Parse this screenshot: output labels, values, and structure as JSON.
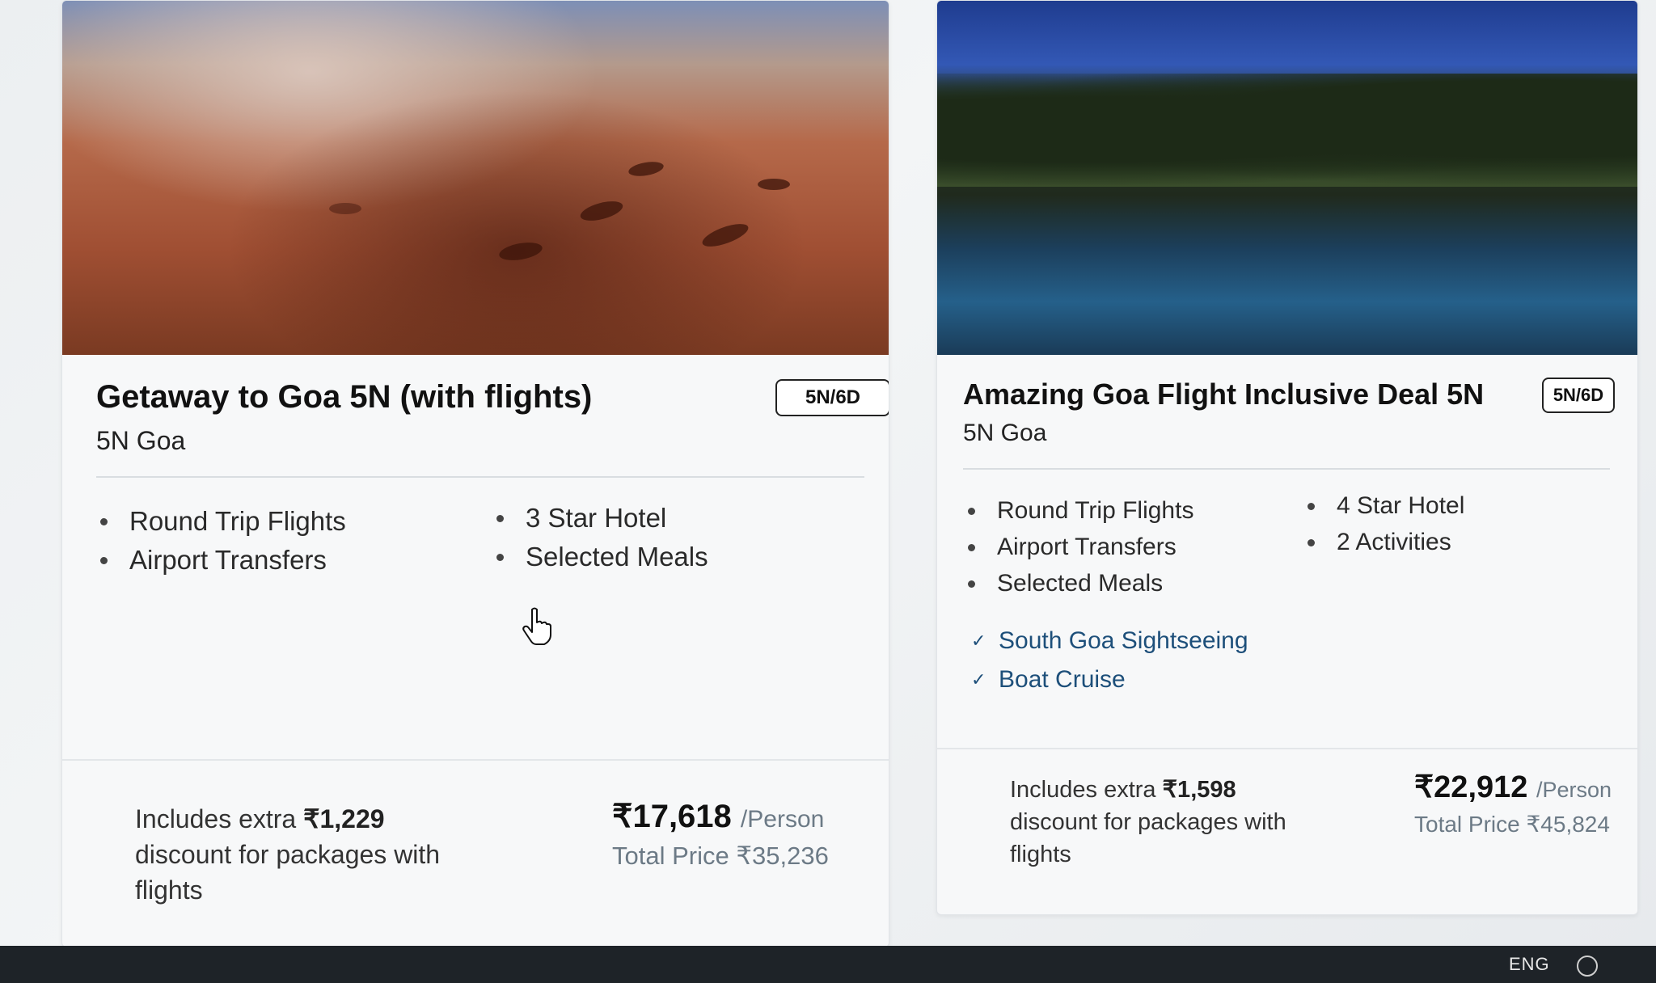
{
  "cards": [
    {
      "title": "Getaway to Goa 5N (with flights)",
      "subtitle": "5N Goa",
      "badge": "5N/6D",
      "features_left": [
        "Round Trip Flights",
        "Airport Transfers"
      ],
      "features_right": [
        "3 Star Hotel",
        "Selected Meals"
      ],
      "highlights": [],
      "discount": {
        "prefix": "Includes extra ",
        "amount": "₹1,229",
        "suffix": " discount for packages with flights"
      },
      "price": "₹17,618",
      "per": "/Person",
      "total": "Total Price ₹35,236"
    },
    {
      "title": "Amazing Goa Flight Inclusive Deal 5N",
      "subtitle": "5N Goa",
      "badge": "5N/6D",
      "features_left": [
        "Round Trip Flights",
        "Airport Transfers",
        "Selected Meals"
      ],
      "features_right": [
        "4 Star Hotel",
        "2 Activities"
      ],
      "highlights": [
        "South Goa Sightseeing",
        "Boat Cruise"
      ],
      "discount": {
        "prefix": "Includes extra ",
        "amount": "₹1,598",
        "suffix": " discount for packages with flights"
      },
      "price": "₹22,912",
      "per": "/Person",
      "total": "Total Price ₹45,824"
    }
  ],
  "taskbar": {
    "language": "ENG"
  },
  "icons": {
    "cursor": "hand-pointer-icon",
    "bullet": "bullet-dot-icon",
    "check": "checkmark-icon",
    "tray": "wifi-icon"
  },
  "colors": {
    "highlight_text": "#1d4f7a",
    "price_secondary": "#6c7a86",
    "taskbar": "#1e2328"
  }
}
